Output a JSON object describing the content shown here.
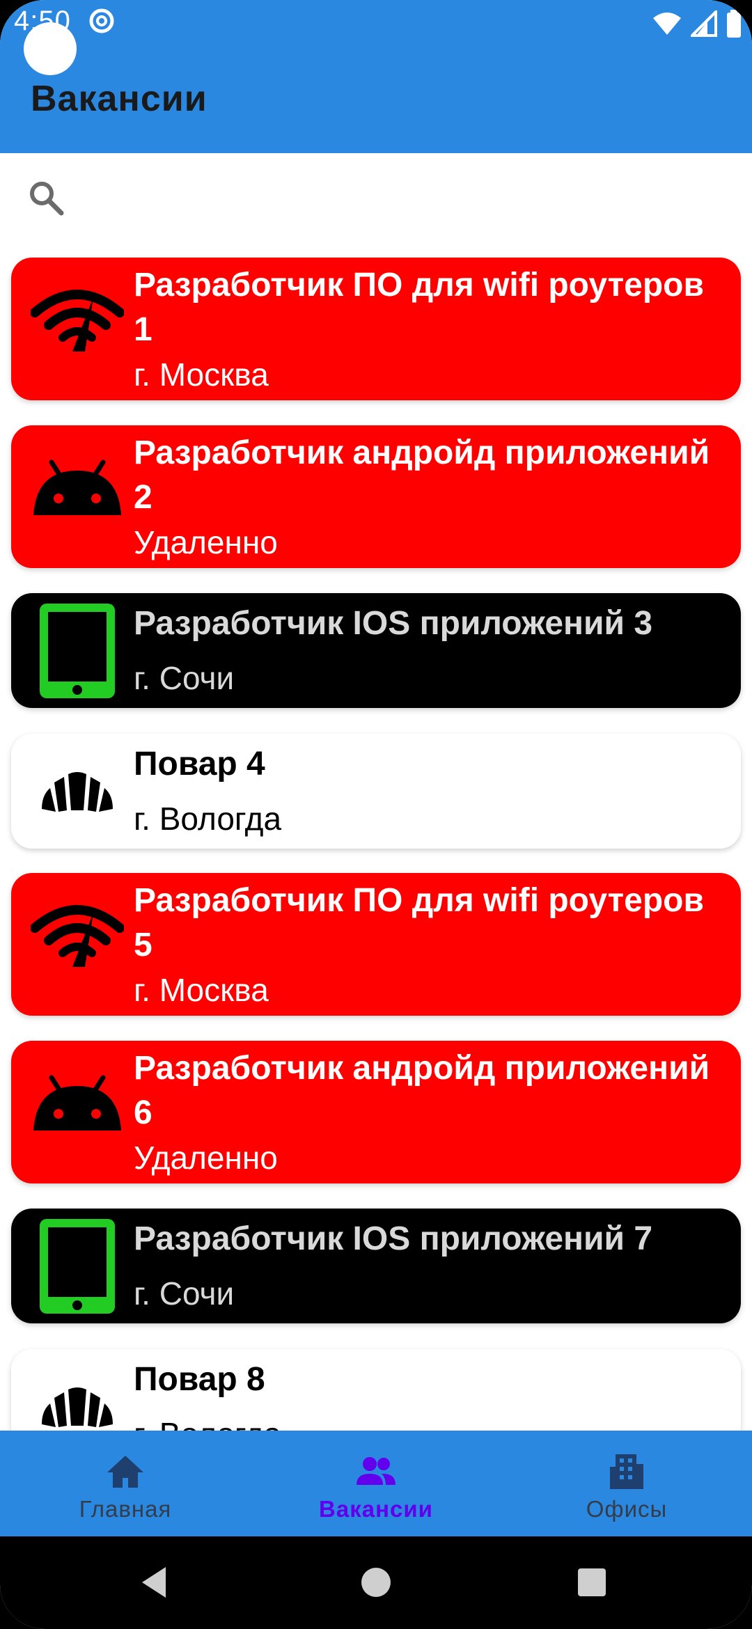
{
  "status_bar": {
    "time": "4:50"
  },
  "app_bar": {
    "title": "Вакансии"
  },
  "search": {
    "placeholder": "",
    "value": ""
  },
  "jobs": [
    {
      "title": "Разработчик ПО для wifi роутеров 1",
      "location": "г. Москва",
      "icon": "wifi-router-icon",
      "bg": "#ff0000",
      "title_color": "#ffffff",
      "subtitle_color": "#ffffff"
    },
    {
      "title": "Разработчик андройд приложений 2",
      "location": "Удаленно",
      "icon": "android-icon",
      "bg": "#ff0000",
      "title_color": "#ffffff",
      "subtitle_color": "#ffffff"
    },
    {
      "title": "Разработчик IOS приложений 3",
      "location": "г. Сочи",
      "icon": "tablet-icon",
      "bg": "#000000",
      "title_color": "#d9d9d9",
      "subtitle_color": "#d9d9d9"
    },
    {
      "title": "Повар 4",
      "location": "г. Вологда",
      "icon": "croissant-icon",
      "bg": "#ffffff",
      "title_color": "#000000",
      "subtitle_color": "#000000"
    },
    {
      "title": "Разработчик ПО для wifi роутеров 5",
      "location": "г. Москва",
      "icon": "wifi-router-icon",
      "bg": "#ff0000",
      "title_color": "#ffffff",
      "subtitle_color": "#ffffff"
    },
    {
      "title": "Разработчик андройд приложений 6",
      "location": "Удаленно",
      "icon": "android-icon",
      "bg": "#ff0000",
      "title_color": "#ffffff",
      "subtitle_color": "#ffffff"
    },
    {
      "title": "Разработчик IOS приложений 7",
      "location": "г. Сочи",
      "icon": "tablet-icon",
      "bg": "#000000",
      "title_color": "#d9d9d9",
      "subtitle_color": "#d9d9d9"
    },
    {
      "title": "Повар 8",
      "location": "г. Вологда",
      "icon": "croissant-icon",
      "bg": "#ffffff",
      "title_color": "#000000",
      "subtitle_color": "#000000"
    }
  ],
  "bottom_nav": {
    "items": [
      {
        "label": "Главная",
        "icon": "home-icon",
        "active": false
      },
      {
        "label": "Вакансии",
        "icon": "people-icon",
        "active": true
      },
      {
        "label": "Офисы",
        "icon": "office-building-icon",
        "active": false
      }
    ],
    "active_color": "#6200ee",
    "inactive_color": "#333c4a"
  },
  "colors": {
    "app_bar": "#2b88e0",
    "tablet_green": "#22cc22"
  }
}
